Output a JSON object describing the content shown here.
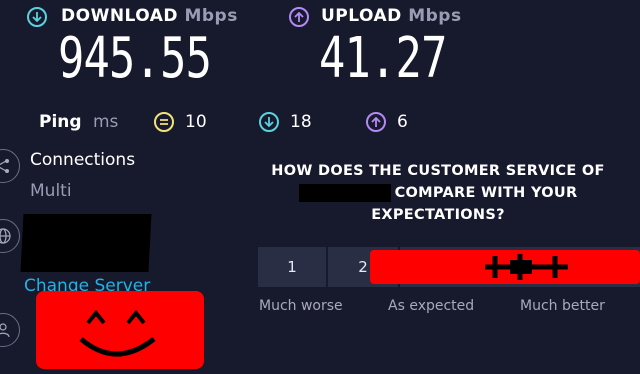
{
  "download": {
    "label": "DOWNLOAD",
    "unit": "Mbps",
    "value": "945.55"
  },
  "upload": {
    "label": "UPLOAD",
    "unit": "Mbps",
    "value": "41.27"
  },
  "ping": {
    "label": "Ping",
    "unit": "ms",
    "idle": "10",
    "download": "18",
    "upload": "6"
  },
  "connections": {
    "label": "Connections",
    "value": "Multi"
  },
  "server": {
    "change_label": "Change Server"
  },
  "survey": {
    "question_line1": "HOW DOES THE CUSTOMER SERVICE OF",
    "question_line2": "COMPARE WITH YOUR",
    "question_line3": "EXPECTATIONS?",
    "ratings": [
      "1",
      "2"
    ],
    "scale_low": "Much worse",
    "scale_mid": "As expected",
    "scale_high": "Much better"
  },
  "colors": {
    "background": "#171a2c",
    "download_accent": "#5bd1e0",
    "upload_accent": "#b489f5",
    "ping_accent": "#f3e27a",
    "link": "#1fb3e8",
    "redaction": "#ff0000"
  }
}
